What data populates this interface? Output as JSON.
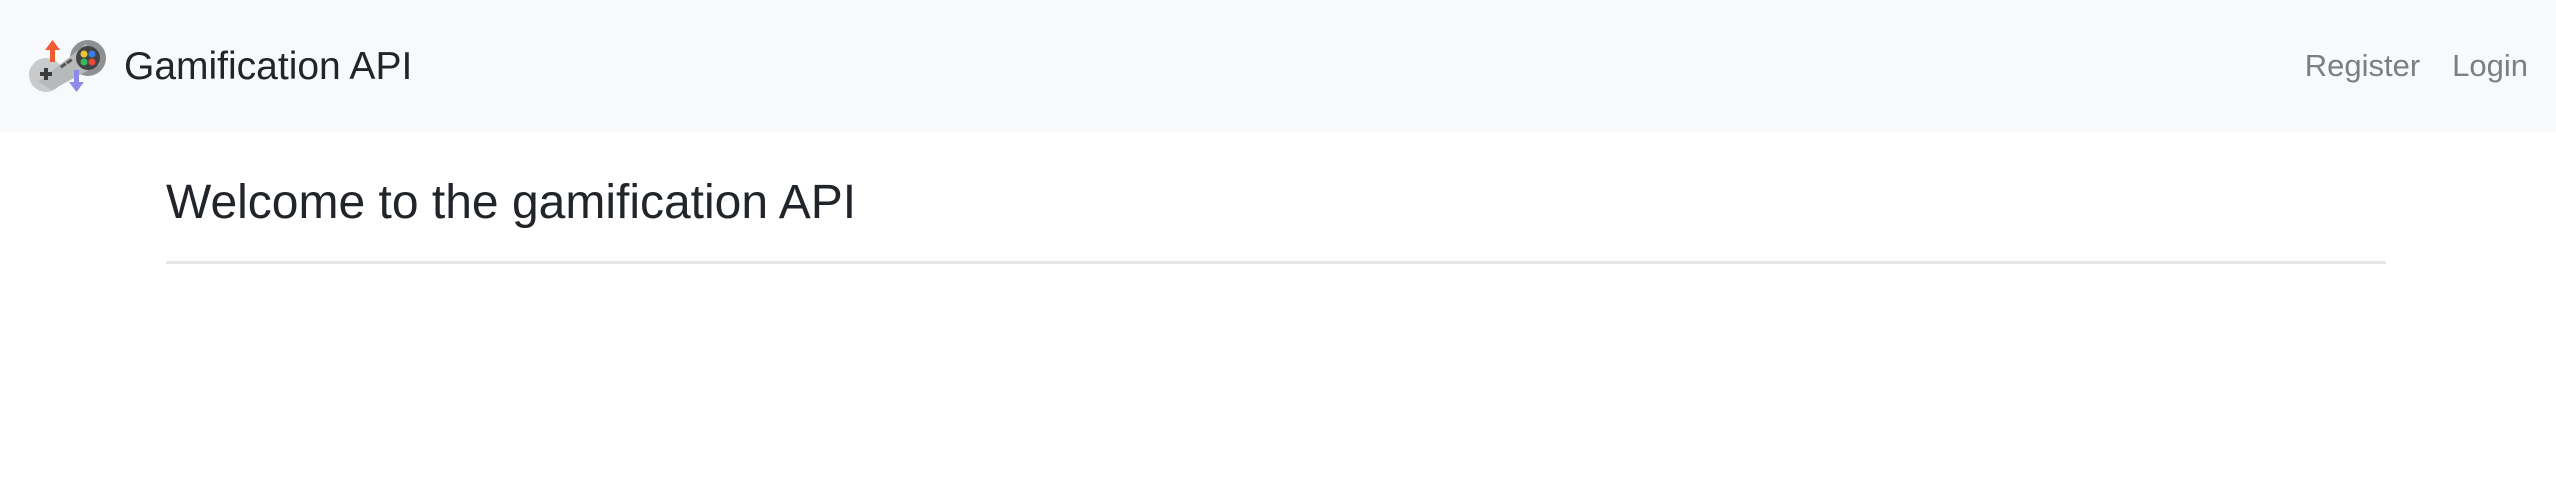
{
  "navbar": {
    "brand_title": "Gamification API",
    "brand_logo_icon": "gamepad-controller-with-arrows-icon",
    "links": {
      "register": "Register",
      "login": "Login"
    }
  },
  "main": {
    "title": "Welcome to the gamification API"
  },
  "colors": {
    "navbar_background": "#f8f9fa",
    "nav_link": "#7b7f83",
    "text": "#212529",
    "divider": "#e6e6e6",
    "arrow_up": "#f25a32",
    "arrow_down": "#8c8ce6"
  }
}
